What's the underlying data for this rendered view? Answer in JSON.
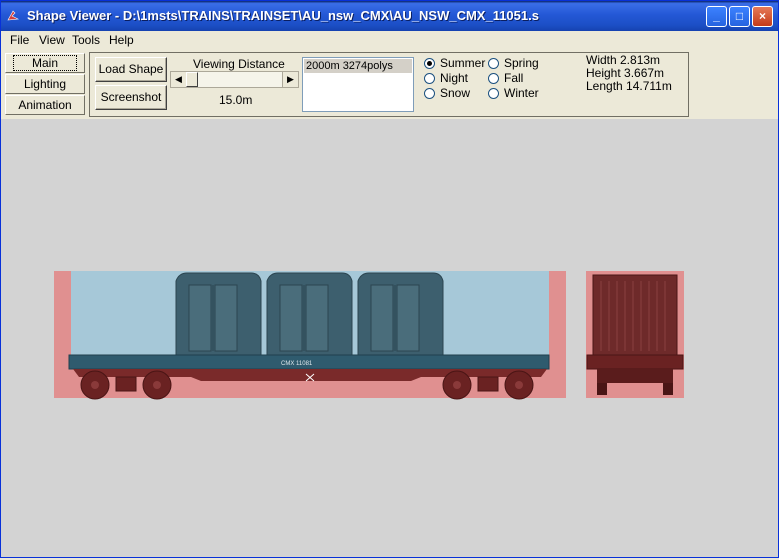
{
  "window": {
    "title": "Shape Viewer - D:\\1msts\\TRAINS\\TRAINSET\\AU_nsw_CMX\\AU_NSW_CMX_11051.s",
    "minimize_label": "_",
    "maximize_label": "□",
    "close_label": "×"
  },
  "menu": [
    {
      "label": "File"
    },
    {
      "label": "View"
    },
    {
      "label": "Tools"
    },
    {
      "label": "Help"
    }
  ],
  "tabs": [
    {
      "label": "Main",
      "active": true
    },
    {
      "label": "Lighting",
      "active": false
    },
    {
      "label": "Animation",
      "active": false
    }
  ],
  "buttons": {
    "load_shape": "Load Shape",
    "screenshot": "Screenshot"
  },
  "viewing_distance": {
    "label": "Viewing Distance",
    "value": "15.0m"
  },
  "lod_list": {
    "items": [
      "2000m 3274polys"
    ],
    "selected": 0
  },
  "seasons": [
    {
      "label": "Summer",
      "checked": true
    },
    {
      "label": "Night",
      "checked": false
    },
    {
      "label": "Snow",
      "checked": false
    },
    {
      "label": "Spring",
      "checked": false
    },
    {
      "label": "Fall",
      "checked": false
    },
    {
      "label": "Winter",
      "checked": false
    }
  ],
  "dimensions": {
    "width": "Width 2.813m",
    "height": "Height 3.667m",
    "length": "Length 14.711m"
  },
  "model": {
    "wagon_number": "CMX 11081"
  },
  "colors": {
    "viewport_bg": "#d3d3d3",
    "bbox_fill": "#e09090",
    "sky_fill": "#a6c8d8",
    "container": "#3d5f6e",
    "deck": "#2f5b6e",
    "underframe": "#7a2a2a"
  }
}
